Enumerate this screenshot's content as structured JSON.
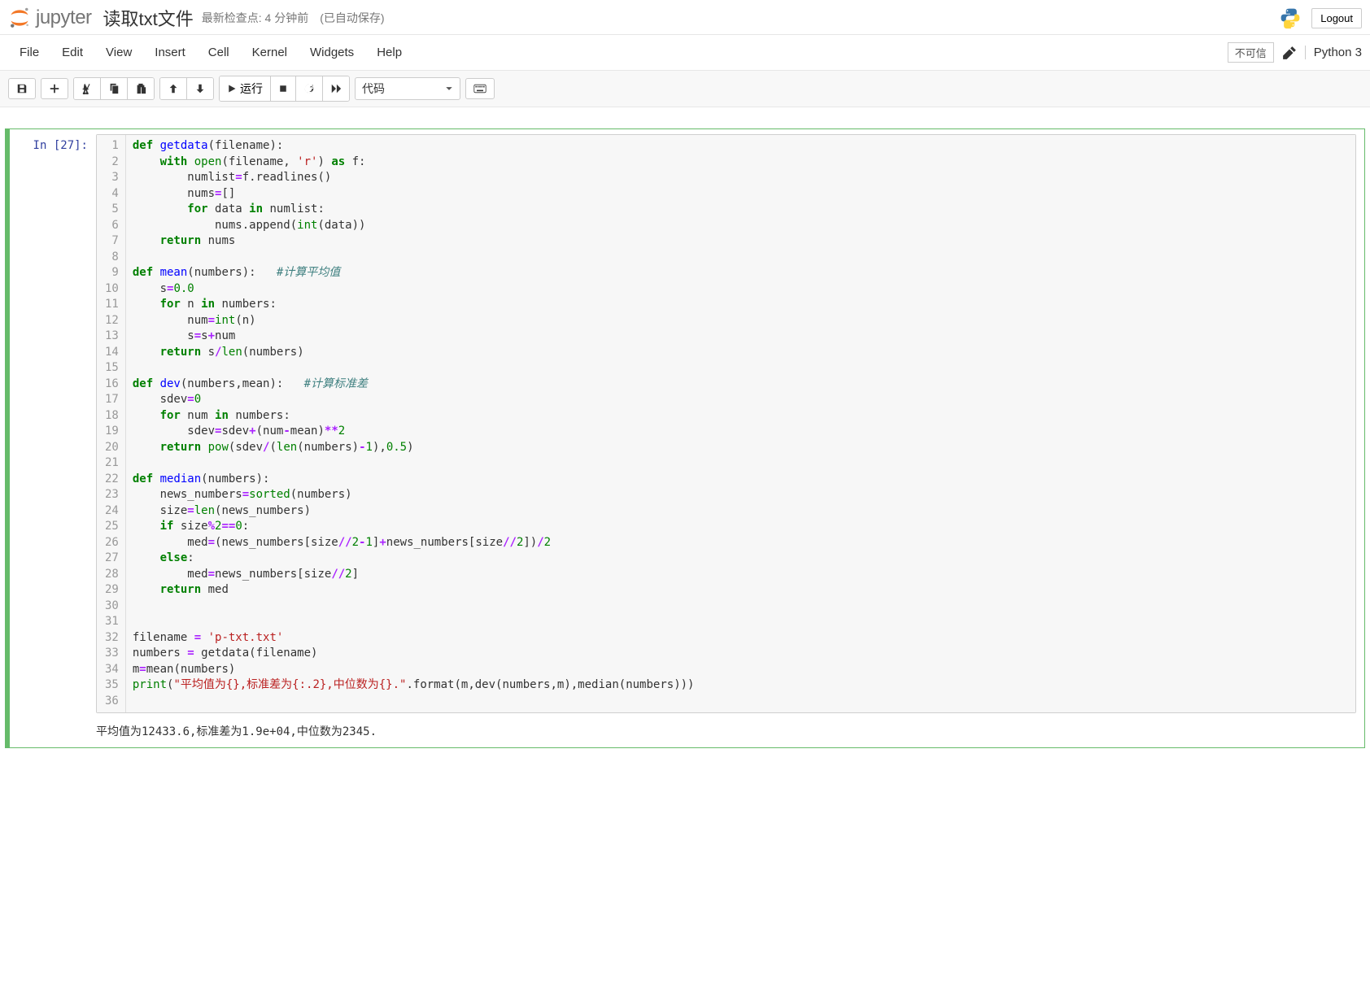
{
  "header": {
    "logo_text": "jupyter",
    "title": "读取txt文件",
    "checkpoint": "最新检查点: 4 分钟前",
    "autosave": "(已自动保存)",
    "logout": "Logout"
  },
  "menu": {
    "file": "File",
    "edit": "Edit",
    "view": "View",
    "insert": "Insert",
    "cell": "Cell",
    "kernel": "Kernel",
    "widgets": "Widgets",
    "help": "Help",
    "not_trusted": "不可信",
    "kernel_name": "Python 3"
  },
  "toolbar": {
    "run": "运行",
    "cell_type": "代码"
  },
  "cell": {
    "prompt_label": "In ",
    "prompt_num": "[27]:",
    "line_count": 36,
    "output": "平均值为12433.6,标准差为1.9e+04,中位数为2345."
  },
  "code_tokens": [
    [
      {
        "t": "def ",
        "c": "kw"
      },
      {
        "t": "getdata",
        "c": "fn"
      },
      {
        "t": "(filename):"
      }
    ],
    [
      {
        "t": "    "
      },
      {
        "t": "with ",
        "c": "kw"
      },
      {
        "t": "open",
        "c": "bi"
      },
      {
        "t": "(filename, "
      },
      {
        "t": "'r'",
        "c": "str"
      },
      {
        "t": ") "
      },
      {
        "t": "as ",
        "c": "kw"
      },
      {
        "t": "f:"
      }
    ],
    [
      {
        "t": "        numlist"
      },
      {
        "t": "=",
        "c": "op"
      },
      {
        "t": "f.readlines()"
      }
    ],
    [
      {
        "t": "        nums"
      },
      {
        "t": "=",
        "c": "op"
      },
      {
        "t": "[]"
      }
    ],
    [
      {
        "t": "        "
      },
      {
        "t": "for ",
        "c": "kw"
      },
      {
        "t": "data "
      },
      {
        "t": "in ",
        "c": "kw"
      },
      {
        "t": "numlist:"
      }
    ],
    [
      {
        "t": "            nums.append("
      },
      {
        "t": "int",
        "c": "bi"
      },
      {
        "t": "(data))"
      }
    ],
    [
      {
        "t": "    "
      },
      {
        "t": "return ",
        "c": "kw"
      },
      {
        "t": "nums"
      }
    ],
    [
      {
        "t": ""
      }
    ],
    [
      {
        "t": "def ",
        "c": "kw"
      },
      {
        "t": "mean",
        "c": "fn"
      },
      {
        "t": "(numbers):   "
      },
      {
        "t": "#计算平均值",
        "c": "cm"
      }
    ],
    [
      {
        "t": "    s"
      },
      {
        "t": "=",
        "c": "op"
      },
      {
        "t": "0.0",
        "c": "num"
      }
    ],
    [
      {
        "t": "    "
      },
      {
        "t": "for ",
        "c": "kw"
      },
      {
        "t": "n "
      },
      {
        "t": "in ",
        "c": "kw"
      },
      {
        "t": "numbers:"
      }
    ],
    [
      {
        "t": "        num"
      },
      {
        "t": "=",
        "c": "op"
      },
      {
        "t": "int",
        "c": "bi"
      },
      {
        "t": "(n)"
      }
    ],
    [
      {
        "t": "        s"
      },
      {
        "t": "=",
        "c": "op"
      },
      {
        "t": "s"
      },
      {
        "t": "+",
        "c": "op"
      },
      {
        "t": "num"
      }
    ],
    [
      {
        "t": "    "
      },
      {
        "t": "return ",
        "c": "kw"
      },
      {
        "t": "s"
      },
      {
        "t": "/",
        "c": "op"
      },
      {
        "t": "len",
        "c": "bi"
      },
      {
        "t": "(numbers)"
      }
    ],
    [
      {
        "t": ""
      }
    ],
    [
      {
        "t": "def ",
        "c": "kw"
      },
      {
        "t": "dev",
        "c": "fn"
      },
      {
        "t": "(numbers,mean):   "
      },
      {
        "t": "#计算标准差",
        "c": "cm"
      }
    ],
    [
      {
        "t": "    sdev"
      },
      {
        "t": "=",
        "c": "op"
      },
      {
        "t": "0",
        "c": "num"
      }
    ],
    [
      {
        "t": "    "
      },
      {
        "t": "for ",
        "c": "kw"
      },
      {
        "t": "num "
      },
      {
        "t": "in ",
        "c": "kw"
      },
      {
        "t": "numbers:"
      }
    ],
    [
      {
        "t": "        sdev"
      },
      {
        "t": "=",
        "c": "op"
      },
      {
        "t": "sdev"
      },
      {
        "t": "+",
        "c": "op"
      },
      {
        "t": "(num"
      },
      {
        "t": "-",
        "c": "op"
      },
      {
        "t": "mean)"
      },
      {
        "t": "**",
        "c": "op"
      },
      {
        "t": "2",
        "c": "num"
      }
    ],
    [
      {
        "t": "    "
      },
      {
        "t": "return ",
        "c": "kw"
      },
      {
        "t": "pow",
        "c": "bi"
      },
      {
        "t": "(sdev"
      },
      {
        "t": "/",
        "c": "op"
      },
      {
        "t": "("
      },
      {
        "t": "len",
        "c": "bi"
      },
      {
        "t": "(numbers)"
      },
      {
        "t": "-",
        "c": "op"
      },
      {
        "t": "1",
        "c": "num"
      },
      {
        "t": "),"
      },
      {
        "t": "0.5",
        "c": "num"
      },
      {
        "t": ")"
      }
    ],
    [
      {
        "t": ""
      }
    ],
    [
      {
        "t": "def ",
        "c": "kw"
      },
      {
        "t": "median",
        "c": "fn"
      },
      {
        "t": "(numbers):"
      }
    ],
    [
      {
        "t": "    news_numbers"
      },
      {
        "t": "=",
        "c": "op"
      },
      {
        "t": "sorted",
        "c": "bi"
      },
      {
        "t": "(numbers)"
      }
    ],
    [
      {
        "t": "    size"
      },
      {
        "t": "=",
        "c": "op"
      },
      {
        "t": "len",
        "c": "bi"
      },
      {
        "t": "(news_numbers)"
      }
    ],
    [
      {
        "t": "    "
      },
      {
        "t": "if ",
        "c": "kw"
      },
      {
        "t": "size"
      },
      {
        "t": "%",
        "c": "op"
      },
      {
        "t": "2",
        "c": "num"
      },
      {
        "t": "==",
        "c": "op"
      },
      {
        "t": "0",
        "c": "num"
      },
      {
        "t": ":"
      }
    ],
    [
      {
        "t": "        med"
      },
      {
        "t": "=",
        "c": "op"
      },
      {
        "t": "(news_numbers[size"
      },
      {
        "t": "//",
        "c": "op"
      },
      {
        "t": "2",
        "c": "num"
      },
      {
        "t": "-",
        "c": "op"
      },
      {
        "t": "1",
        "c": "num"
      },
      {
        "t": "]"
      },
      {
        "t": "+",
        "c": "op"
      },
      {
        "t": "news_numbers[size"
      },
      {
        "t": "//",
        "c": "op"
      },
      {
        "t": "2",
        "c": "num"
      },
      {
        "t": "])"
      },
      {
        "t": "/",
        "c": "op"
      },
      {
        "t": "2",
        "c": "num"
      }
    ],
    [
      {
        "t": "    "
      },
      {
        "t": "else",
        "c": "kw"
      },
      {
        "t": ":"
      }
    ],
    [
      {
        "t": "        med"
      },
      {
        "t": "=",
        "c": "op"
      },
      {
        "t": "news_numbers[size"
      },
      {
        "t": "//",
        "c": "op"
      },
      {
        "t": "2",
        "c": "num"
      },
      {
        "t": "]"
      }
    ],
    [
      {
        "t": "    "
      },
      {
        "t": "return ",
        "c": "kw"
      },
      {
        "t": "med"
      }
    ],
    [
      {
        "t": ""
      }
    ],
    [
      {
        "t": ""
      }
    ],
    [
      {
        "t": "filename "
      },
      {
        "t": "=",
        "c": "op"
      },
      {
        "t": " "
      },
      {
        "t": "'p-txt.txt'",
        "c": "str"
      }
    ],
    [
      {
        "t": "numbers "
      },
      {
        "t": "=",
        "c": "op"
      },
      {
        "t": " getdata(filename)"
      }
    ],
    [
      {
        "t": "m"
      },
      {
        "t": "=",
        "c": "op"
      },
      {
        "t": "mean(numbers)"
      }
    ],
    [
      {
        "t": "print",
        "c": "bi"
      },
      {
        "t": "("
      },
      {
        "t": "\"平均值为{},标准差为{:.2},中位数为{}.\"",
        "c": "str"
      },
      {
        "t": ".format(m,dev(numbers,m),median(numbers)))"
      }
    ],
    [
      {
        "t": ""
      }
    ]
  ]
}
